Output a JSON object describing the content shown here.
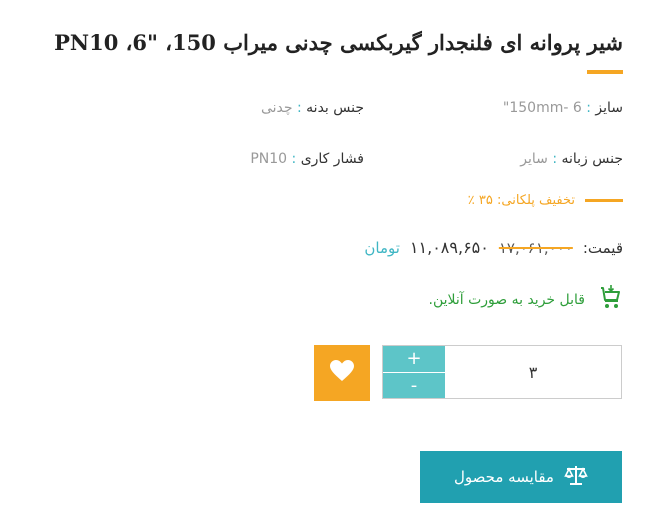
{
  "product": {
    "title": "شیر پروانه ای فلنجدار گیربکسی چدنی میراب 150، \"6، PN10"
  },
  "specs": [
    {
      "label": "سایز",
      "value": "150mm- 6\""
    },
    {
      "label": "جنس بدنه",
      "value": "چدنی"
    },
    {
      "label": "جنس زبانه",
      "value": "سایر"
    },
    {
      "label": "فشار کاری",
      "value": "PN10"
    }
  ],
  "separator": ":",
  "discount": {
    "text": "تخفیف پلکانی: ۳۵ ٪"
  },
  "price": {
    "label": "قیمت:",
    "old": "۱۷,۰۶۱,۰۰۰",
    "new": "۱۱,۰۸۹,۶۵۰",
    "currency": "تومان"
  },
  "online": {
    "text": "قابل خرید به صورت آنلاین."
  },
  "quantity": {
    "value": "۳",
    "plus": "+",
    "minus": "-"
  },
  "compare": {
    "label": "مقایسه محصول"
  },
  "colors": {
    "accent": "#f5a623",
    "teal": "#21a0b0",
    "green": "#2e9e3a"
  },
  "icons": [
    "cart-check-icon",
    "heart-icon",
    "balance-scale-icon"
  ]
}
